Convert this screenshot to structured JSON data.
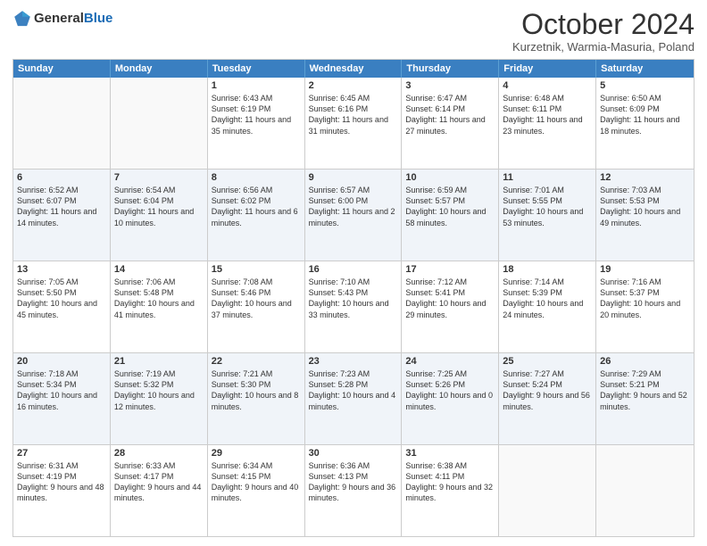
{
  "header": {
    "logo_general": "General",
    "logo_blue": "Blue",
    "title": "October 2024",
    "subtitle": "Kurzetnik, Warmia-Masuria, Poland"
  },
  "calendar": {
    "days_of_week": [
      "Sunday",
      "Monday",
      "Tuesday",
      "Wednesday",
      "Thursday",
      "Friday",
      "Saturday"
    ],
    "rows": [
      [
        {
          "day": "",
          "text": ""
        },
        {
          "day": "",
          "text": ""
        },
        {
          "day": "1",
          "text": "Sunrise: 6:43 AM\nSunset: 6:19 PM\nDaylight: 11 hours and 35 minutes."
        },
        {
          "day": "2",
          "text": "Sunrise: 6:45 AM\nSunset: 6:16 PM\nDaylight: 11 hours and 31 minutes."
        },
        {
          "day": "3",
          "text": "Sunrise: 6:47 AM\nSunset: 6:14 PM\nDaylight: 11 hours and 27 minutes."
        },
        {
          "day": "4",
          "text": "Sunrise: 6:48 AM\nSunset: 6:11 PM\nDaylight: 11 hours and 23 minutes."
        },
        {
          "day": "5",
          "text": "Sunrise: 6:50 AM\nSunset: 6:09 PM\nDaylight: 11 hours and 18 minutes."
        }
      ],
      [
        {
          "day": "6",
          "text": "Sunrise: 6:52 AM\nSunset: 6:07 PM\nDaylight: 11 hours and 14 minutes."
        },
        {
          "day": "7",
          "text": "Sunrise: 6:54 AM\nSunset: 6:04 PM\nDaylight: 11 hours and 10 minutes."
        },
        {
          "day": "8",
          "text": "Sunrise: 6:56 AM\nSunset: 6:02 PM\nDaylight: 11 hours and 6 minutes."
        },
        {
          "day": "9",
          "text": "Sunrise: 6:57 AM\nSunset: 6:00 PM\nDaylight: 11 hours and 2 minutes."
        },
        {
          "day": "10",
          "text": "Sunrise: 6:59 AM\nSunset: 5:57 PM\nDaylight: 10 hours and 58 minutes."
        },
        {
          "day": "11",
          "text": "Sunrise: 7:01 AM\nSunset: 5:55 PM\nDaylight: 10 hours and 53 minutes."
        },
        {
          "day": "12",
          "text": "Sunrise: 7:03 AM\nSunset: 5:53 PM\nDaylight: 10 hours and 49 minutes."
        }
      ],
      [
        {
          "day": "13",
          "text": "Sunrise: 7:05 AM\nSunset: 5:50 PM\nDaylight: 10 hours and 45 minutes."
        },
        {
          "day": "14",
          "text": "Sunrise: 7:06 AM\nSunset: 5:48 PM\nDaylight: 10 hours and 41 minutes."
        },
        {
          "day": "15",
          "text": "Sunrise: 7:08 AM\nSunset: 5:46 PM\nDaylight: 10 hours and 37 minutes."
        },
        {
          "day": "16",
          "text": "Sunrise: 7:10 AM\nSunset: 5:43 PM\nDaylight: 10 hours and 33 minutes."
        },
        {
          "day": "17",
          "text": "Sunrise: 7:12 AM\nSunset: 5:41 PM\nDaylight: 10 hours and 29 minutes."
        },
        {
          "day": "18",
          "text": "Sunrise: 7:14 AM\nSunset: 5:39 PM\nDaylight: 10 hours and 24 minutes."
        },
        {
          "day": "19",
          "text": "Sunrise: 7:16 AM\nSunset: 5:37 PM\nDaylight: 10 hours and 20 minutes."
        }
      ],
      [
        {
          "day": "20",
          "text": "Sunrise: 7:18 AM\nSunset: 5:34 PM\nDaylight: 10 hours and 16 minutes."
        },
        {
          "day": "21",
          "text": "Sunrise: 7:19 AM\nSunset: 5:32 PM\nDaylight: 10 hours and 12 minutes."
        },
        {
          "day": "22",
          "text": "Sunrise: 7:21 AM\nSunset: 5:30 PM\nDaylight: 10 hours and 8 minutes."
        },
        {
          "day": "23",
          "text": "Sunrise: 7:23 AM\nSunset: 5:28 PM\nDaylight: 10 hours and 4 minutes."
        },
        {
          "day": "24",
          "text": "Sunrise: 7:25 AM\nSunset: 5:26 PM\nDaylight: 10 hours and 0 minutes."
        },
        {
          "day": "25",
          "text": "Sunrise: 7:27 AM\nSunset: 5:24 PM\nDaylight: 9 hours and 56 minutes."
        },
        {
          "day": "26",
          "text": "Sunrise: 7:29 AM\nSunset: 5:21 PM\nDaylight: 9 hours and 52 minutes."
        }
      ],
      [
        {
          "day": "27",
          "text": "Sunrise: 6:31 AM\nSunset: 4:19 PM\nDaylight: 9 hours and 48 minutes."
        },
        {
          "day": "28",
          "text": "Sunrise: 6:33 AM\nSunset: 4:17 PM\nDaylight: 9 hours and 44 minutes."
        },
        {
          "day": "29",
          "text": "Sunrise: 6:34 AM\nSunset: 4:15 PM\nDaylight: 9 hours and 40 minutes."
        },
        {
          "day": "30",
          "text": "Sunrise: 6:36 AM\nSunset: 4:13 PM\nDaylight: 9 hours and 36 minutes."
        },
        {
          "day": "31",
          "text": "Sunrise: 6:38 AM\nSunset: 4:11 PM\nDaylight: 9 hours and 32 minutes."
        },
        {
          "day": "",
          "text": ""
        },
        {
          "day": "",
          "text": ""
        }
      ]
    ]
  }
}
